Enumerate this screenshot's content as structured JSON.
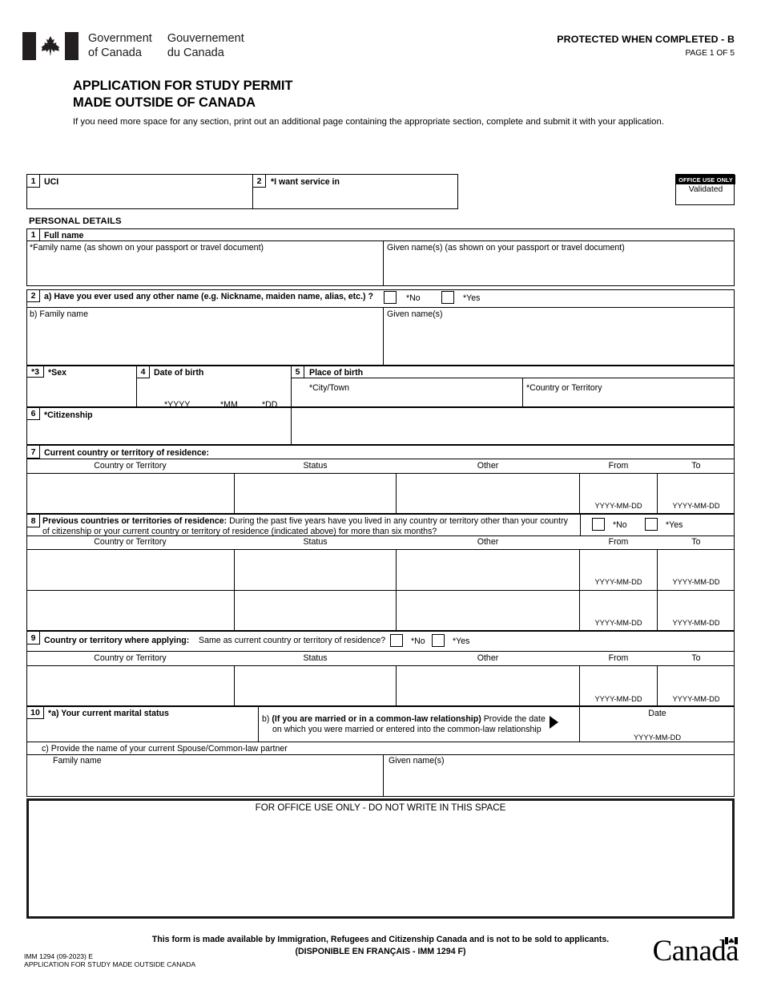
{
  "header": {
    "gov_en_l1": "Government",
    "gov_en_l2": "of Canada",
    "gov_fr_l1": "Gouvernement",
    "gov_fr_l2": "du Canada",
    "protected": "PROTECTED WHEN COMPLETED - B",
    "page_number": "PAGE 1 OF 5",
    "flag_icon": "canada-flag-icon"
  },
  "title": {
    "line1": "APPLICATION FOR STUDY PERMIT",
    "line2": "MADE OUTSIDE OF CANADA",
    "instruction": "If you need more space for any section, print out an additional page containing the appropriate section, complete and submit it with your application."
  },
  "top_row": {
    "uci": {
      "num": "1",
      "label": "UCI",
      "value": ""
    },
    "service": {
      "num": "2",
      "label": "*I want service in",
      "value": ""
    },
    "office_use": {
      "header": "OFFICE USE ONLY",
      "text": "Validated"
    }
  },
  "personal_details": {
    "heading": "PERSONAL DETAILS",
    "f1": {
      "num": "1",
      "label": "Full name",
      "family_label": "*Family name (as shown on your passport or travel document)",
      "given_label": "Given name(s) (as shown on your passport or travel document)",
      "family_value": "",
      "given_value": ""
    },
    "f2": {
      "num": "2",
      "question": "a) Have you ever used any other name (e.g. Nickname, maiden name, alias, etc.) ?",
      "no_label": "*No",
      "yes_label": "*Yes",
      "family_label": "b) Family name",
      "given_label": "Given name(s)",
      "family_value": "",
      "given_value": ""
    },
    "f3": {
      "num": "*3",
      "label": "*Sex",
      "value": ""
    },
    "f4": {
      "num": "4",
      "label": "Date of birth",
      "yyyy": "*YYYY",
      "mm": "*MM",
      "dd": "*DD",
      "yyyy_value": "",
      "mm_value": "",
      "dd_value": ""
    },
    "f5": {
      "num": "5",
      "label": "Place of birth",
      "city_label": "*City/Town",
      "country_label": "*Country or Territory",
      "city_value": "",
      "country_value": ""
    },
    "f6": {
      "num": "6",
      "label": "*Citizenship",
      "value": ""
    },
    "f7": {
      "num": "7",
      "label": "Current country or territory of residence:",
      "columns": [
        "Country or Territory",
        "Status",
        "Other",
        "From",
        "To"
      ],
      "date_hint": "YYYY-MM-DD",
      "rows": [
        {
          "country": "",
          "status": "",
          "other": "",
          "from": "",
          "to": ""
        }
      ]
    },
    "f8": {
      "num": "8",
      "label_bold": "Previous countries or territories of residence:",
      "label_rest_l1": " During the past five years have you lived in any country or territory other than your country",
      "label_l2": "of citizenship or your current country or territory of residence (indicated above) for more than six months?",
      "no_label": "*No",
      "yes_label": "*Yes",
      "columns": [
        "Country or Territory",
        "Status",
        "Other",
        "From",
        "To"
      ],
      "date_hint": "YYYY-MM-DD",
      "rows": [
        {
          "country": "",
          "status": "",
          "other": "",
          "from": "",
          "to": ""
        },
        {
          "country": "",
          "status": "",
          "other": "",
          "from": "",
          "to": ""
        }
      ]
    },
    "f9": {
      "num": "9",
      "label_bold": "Country or territory  where applying:",
      "question": "Same as current country or territory of residence?",
      "no_label": "*No",
      "yes_label": "*Yes",
      "columns": [
        "Country or Territory",
        "Status",
        "Other",
        "From",
        "To"
      ],
      "date_hint": "YYYY-MM-DD",
      "rows": [
        {
          "country": "",
          "status": "",
          "other": "",
          "from": "",
          "to": ""
        }
      ]
    },
    "f10": {
      "num": "10",
      "a_label": "*a) Your current marital status",
      "a_value": "",
      "b_lead": "b) ",
      "b_bold": "(If you are married or in a common-law relationship)",
      "b_rest": " Provide the date",
      "b_line2": "on which you were married or entered into the common-law relationship",
      "arrow_icon": "triangle-right-icon",
      "date_label": "Date",
      "date_hint": "YYYY-MM-DD",
      "date_value": "",
      "c_label": "c) Provide the name of your current Spouse/Common-law partner",
      "family_label": "Family name",
      "given_label": "Given name(s)",
      "family_value": "",
      "given_value": ""
    }
  },
  "office_block": {
    "title": "FOR OFFICE USE ONLY - DO NOT WRITE IN THIS SPACE"
  },
  "footer": {
    "line1": "This form is made available by Immigration, Refugees and Citizenship Canada and is not to be sold to applicants.",
    "line2": "(DISPONIBLE EN FRANÇAIS - IMM 1294 F)",
    "form_code": "IMM 1294 (09-2023) E",
    "form_title": "APPLICATION FOR STUDY MADE OUTSIDE CANADA",
    "wordmark": "Canada",
    "wordmark_flag_icon": "canada-flag-small-icon"
  }
}
